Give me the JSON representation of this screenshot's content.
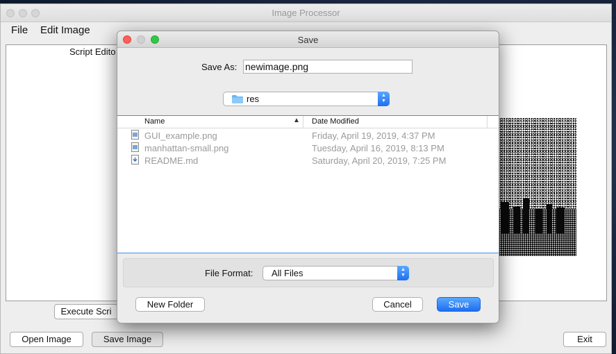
{
  "main_window": {
    "title": "Image Processor",
    "menu": [
      "File",
      "Edit Image"
    ],
    "script_editor_label": "Script Edito",
    "buttons": {
      "execute_script": "Execute Scri",
      "open_image": "Open Image",
      "save_image": "Save Image",
      "exit": "Exit"
    }
  },
  "dialog": {
    "title": "Save",
    "save_as_label": "Save As:",
    "save_as_value": "newimage.png",
    "folder": "res",
    "columns": {
      "name": "Name",
      "date_modified": "Date Modified"
    },
    "files": [
      {
        "name": "GUI_example.png",
        "date": "Friday, April 19, 2019, 4:37 PM",
        "icon": "image-file-icon"
      },
      {
        "name": "manhattan-small.png",
        "date": "Tuesday, April 16, 2019, 8:13 PM",
        "icon": "image-file-icon"
      },
      {
        "name": "README.md",
        "date": "Saturday, April 20, 2019, 7:25 PM",
        "icon": "text-file-icon"
      }
    ],
    "file_format_label": "File Format:",
    "file_format_value": "All Files",
    "buttons": {
      "new_folder": "New Folder",
      "cancel": "Cancel",
      "save": "Save"
    }
  },
  "colors": {
    "accent": "#2b7cf6",
    "close": "#fc5f57",
    "zoom": "#33c748"
  }
}
